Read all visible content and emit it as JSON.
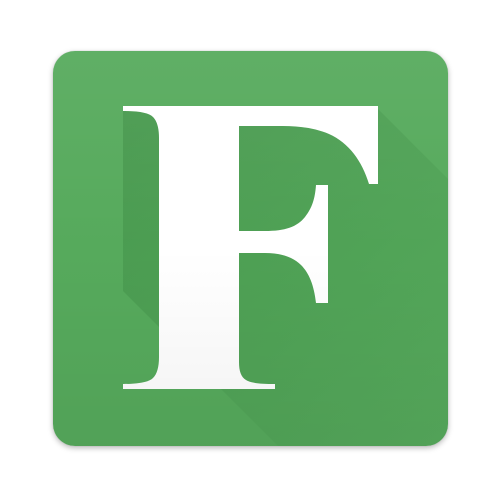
{
  "icon": {
    "letter": "F",
    "name": "f-letter-icon",
    "colors": {
      "tile": "#56aa5c",
      "tile_light": "#5aad60",
      "tile_shadow": "#3f8f46",
      "letter": "#ffffff",
      "page_background": "#ffffff"
    }
  }
}
